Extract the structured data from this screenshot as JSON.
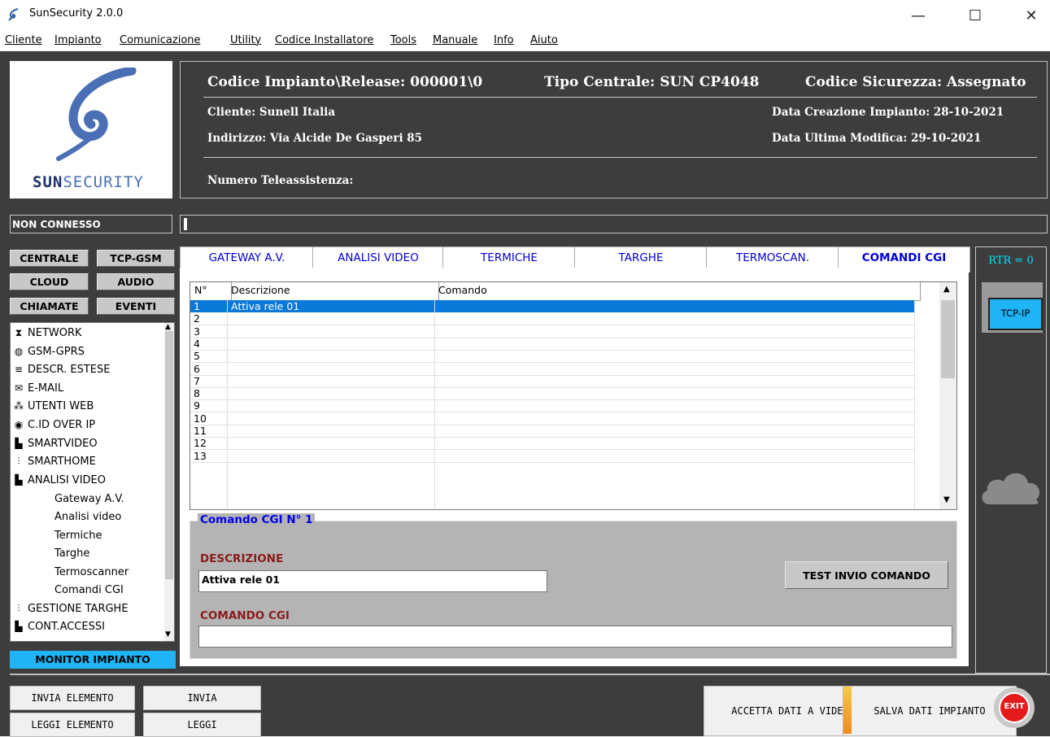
{
  "window": {
    "title": "SunSecurity 2.0.0",
    "minimize": "—",
    "maximize": "☐",
    "close": "✕"
  },
  "menu": [
    "Cliente",
    "Impianto",
    "Comunicazione",
    "Utility",
    "Codice Installatore",
    "Tools",
    "Manuale",
    "Info",
    "Aiuto"
  ],
  "brand": {
    "logo_text_a": "SUN",
    "logo_text_b": "SECURITY",
    "logo_color": "#4a6fb5"
  },
  "info": {
    "codice_impianto": "Codice Impianto\\Release: 000001\\0",
    "tipo_centrale": "Tipo Centrale: SUN CP4048",
    "codice_sicurezza": "Codice Sicurezza: Assegnato",
    "cliente": "Cliente: Sunell Italia",
    "indirizzo": "Indirizzo: Via Alcide De Gasperi 85",
    "data_creazione": "Data Creazione Impianto: 28-10-2021",
    "data_modifica": "Data Ultima Modifica: 29-10-2021",
    "teleassistenza": "Numero Teleassistenza:"
  },
  "status": {
    "connection": "NON CONNESSO"
  },
  "side_buttons": [
    "CENTRALE",
    "TCP-GSM",
    "CLOUD",
    "AUDIO",
    "CHIAMATE",
    "EVENTI"
  ],
  "tree": [
    {
      "icon": "network-icon",
      "glyph": "⧗",
      "label": "NETWORK"
    },
    {
      "icon": "globe-icon",
      "glyph": "◍",
      "label": "GSM-GPRS"
    },
    {
      "icon": "list-icon",
      "glyph": "≡",
      "label": "DESCR. ESTESE"
    },
    {
      "icon": "mail-icon",
      "glyph": "✉",
      "label": "E-MAIL"
    },
    {
      "icon": "users-icon",
      "glyph": "⁂",
      "label": "UTENTI WEB"
    },
    {
      "icon": "cid-icon",
      "glyph": "◉",
      "label": "C.ID OVER IP"
    },
    {
      "icon": "camera-people-icon",
      "glyph": "▙",
      "label": "SMARTVIDEO"
    },
    {
      "icon": "sliders-icon",
      "glyph": "⫶",
      "label": "SMARTHOME"
    },
    {
      "icon": "camera-people-icon",
      "glyph": "▙",
      "label": "ANALISI VIDEO"
    }
  ],
  "tree_sub": [
    "Gateway A.V.",
    "Analisi video",
    "Termiche",
    "Targhe",
    "Termoscanner",
    "Comandi CGI"
  ],
  "tree_tail": [
    {
      "icon": "sliders-icon",
      "glyph": "⫶",
      "label": "GESTIONE TARGHE"
    },
    {
      "icon": "camera-people-icon",
      "glyph": "▙",
      "label": "CONT.ACCESSI"
    }
  ],
  "monitor": "MONITOR IMPIANTO",
  "tabs": [
    "GATEWAY A.V.",
    "ANALISI VIDEO",
    "TERMICHE",
    "TARGHE",
    "TERMOSCAN.",
    "COMANDI CGI"
  ],
  "grid": {
    "headers": [
      "N°",
      "Descrizione",
      "Comando"
    ],
    "rows": [
      {
        "n": "1",
        "d": "Attiva rele 01"
      },
      {
        "n": "2",
        "d": ""
      },
      {
        "n": "3",
        "d": ""
      },
      {
        "n": "4",
        "d": ""
      },
      {
        "n": "5",
        "d": ""
      },
      {
        "n": "6",
        "d": ""
      },
      {
        "n": "7",
        "d": ""
      },
      {
        "n": "8",
        "d": ""
      },
      {
        "n": "9",
        "d": ""
      },
      {
        "n": "10",
        "d": ""
      },
      {
        "n": "11",
        "d": ""
      },
      {
        "n": "12",
        "d": ""
      },
      {
        "n": "13",
        "d": ""
      }
    ],
    "selected_color": "#0a78d7"
  },
  "cmd": {
    "legend": "Comando CGI N° 1",
    "descr_label": "DESCRIZIONE",
    "descr_value": "Attiva rele 01",
    "cmd_label": "COMANDO CGI",
    "cmd_value": "",
    "test_button": "TEST INVIO COMANDO"
  },
  "right": {
    "rtr": "RTR = 0",
    "tcpip": "TCP-IP"
  },
  "bottom": {
    "invia_elemento": "INVIA ELEMENTO",
    "invia": "INVIA",
    "leggi_elemento": "LEGGI ELEMENTO",
    "leggi": "LEGGI",
    "accetta": "ACCETTA DATI A VIDEO",
    "salva": "SALVA DATI IMPIANTO",
    "exit": "EXIT"
  }
}
